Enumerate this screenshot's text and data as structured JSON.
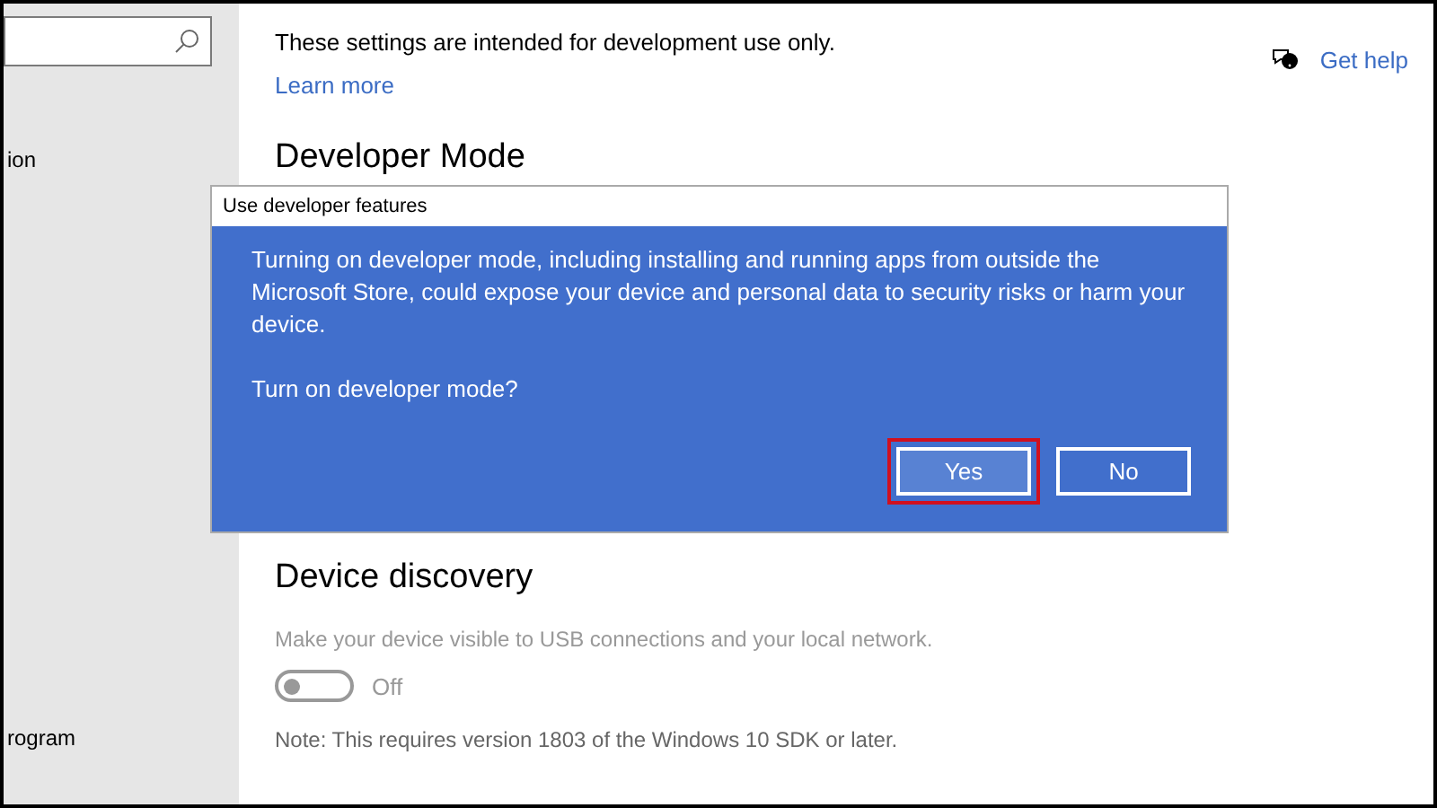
{
  "sidebar": {
    "items": [
      {
        "label": "ion"
      },
      {
        "label": "rogram"
      }
    ]
  },
  "header": {
    "intro": "These settings are intended for development use only.",
    "learn_more": "Learn more",
    "help": "Get help"
  },
  "developer_mode": {
    "title": "Developer Mode"
  },
  "dialog": {
    "title": "Use developer features",
    "message": "Turning on developer mode, including installing and running apps from outside the Microsoft Store, could expose your device and personal data to security risks or harm your device.",
    "question": "Turn on developer mode?",
    "buttons": [
      {
        "label": "Yes",
        "highlighted": true
      },
      {
        "label": "No",
        "highlighted": false
      }
    ]
  },
  "device_discovery": {
    "title": "Device discovery",
    "description": "Make your device visible to USB connections and your local network.",
    "toggle": {
      "on": false,
      "label": "Off"
    },
    "note": "Note: This requires version 1803 of the Windows 10 SDK or later."
  }
}
